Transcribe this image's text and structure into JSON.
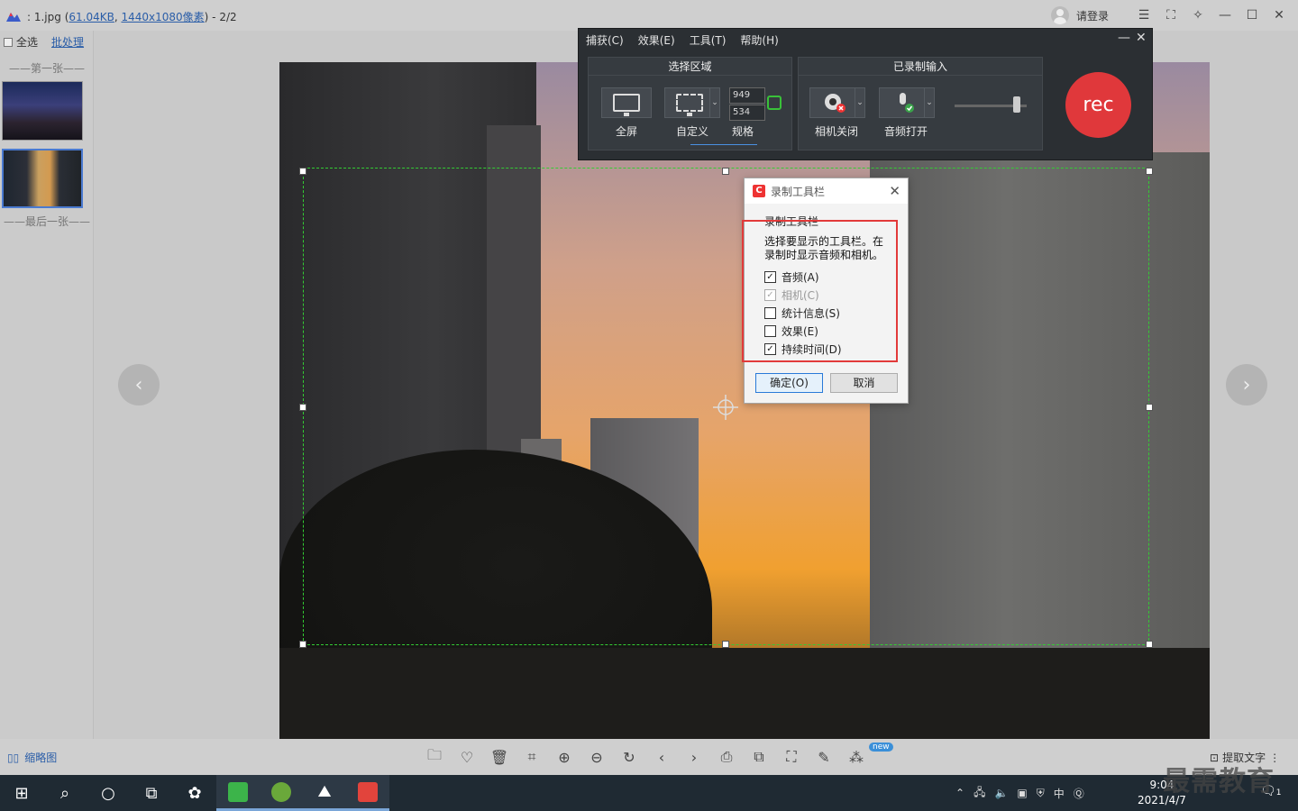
{
  "titlebar": {
    "prefix": ": 1.jpg (",
    "filesize": "61.04KB",
    "sep": ", ",
    "dimensions": "1440x1080像素",
    "suffix": ") - 2/2",
    "login_label": "请登录"
  },
  "sidebar": {
    "select_all": "全选",
    "batch": "批处理",
    "first_label": "——第一张——",
    "last_label": "——最后一张——"
  },
  "bottombar": {
    "thumbnails_label": "缩略图",
    "new_badge": "new",
    "extract_text": "提取文字"
  },
  "taskbar": {
    "time": "9:04",
    "date": "2021/4/7",
    "ime": "中",
    "notif_count": "1"
  },
  "watermark": "最需教育",
  "recorder": {
    "menu": [
      "捕获(C)",
      "效果(E)",
      "工具(T)",
      "帮助(H)"
    ],
    "group1_title": "选择区域",
    "group2_title": "已录制输入",
    "fullscreen_label": "全屏",
    "custom_label": "自定义",
    "width_value": "949",
    "height_value": "534",
    "spec_label": "规格",
    "camera_label": "相机关闭",
    "audio_label": "音频打开",
    "rec_label": "rec"
  },
  "dialog": {
    "title": "录制工具栏",
    "group_label": "录制工具栏",
    "description": "选择要显示的工具栏。在录制时显示音频和相机。",
    "options": [
      {
        "label": "音频(A)",
        "checked": true,
        "disabled": false
      },
      {
        "label": "相机(C)",
        "checked": true,
        "disabled": true
      },
      {
        "label": "统计信息(S)",
        "checked": false,
        "disabled": false
      },
      {
        "label": "效果(E)",
        "checked": false,
        "disabled": false
      },
      {
        "label": "持续时间(D)",
        "checked": true,
        "disabled": false
      }
    ],
    "ok_label": "确定(O)",
    "cancel_label": "取消"
  },
  "colors": {
    "accent": "#2b5ea8",
    "rec_red": "#e0383b",
    "selection_green": "#33cc33",
    "highlight_red": "#e23a3a"
  }
}
